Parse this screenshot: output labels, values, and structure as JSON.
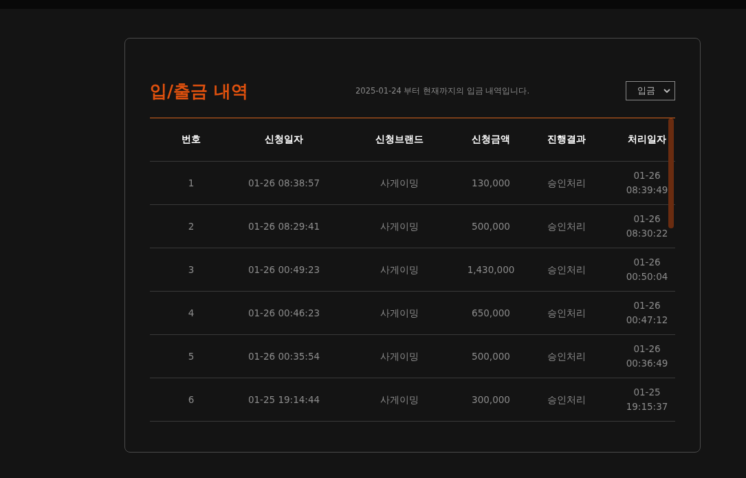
{
  "title": "입/출금 내역",
  "notice": "2025-01-24 부터 현재까지의 입금 내역입니다.",
  "filter": {
    "value": "입금"
  },
  "table": {
    "columns": [
      "번호",
      "신청일자",
      "신청브랜드",
      "신청금액",
      "진행결과",
      "처리일자"
    ],
    "rows": [
      {
        "cells": [
          "1",
          "01-26 08:38:57",
          "사게이밍",
          "130,000",
          "승인처리",
          "01-26 08:39:49"
        ]
      },
      {
        "cells": [
          "2",
          "01-26 08:29:41",
          "사게이밍",
          "500,000",
          "승인처리",
          "01-26 08:30:22"
        ]
      },
      {
        "cells": [
          "3",
          "01-26 00:49:23",
          "사게이밍",
          "1,430,000",
          "승인처리",
          "01-26 00:50:04"
        ]
      },
      {
        "cells": [
          "4",
          "01-26 00:46:23",
          "사게이밍",
          "650,000",
          "승인처리",
          "01-26 00:47:12"
        ]
      },
      {
        "cells": [
          "5",
          "01-26 00:35:54",
          "사게이밍",
          "500,000",
          "승인처리",
          "01-26 00:36:49"
        ]
      },
      {
        "cells": [
          "6",
          "01-25 19:14:44",
          "사게이밍",
          "300,000",
          "승인처리",
          "01-25 19:15:37"
        ]
      }
    ]
  }
}
